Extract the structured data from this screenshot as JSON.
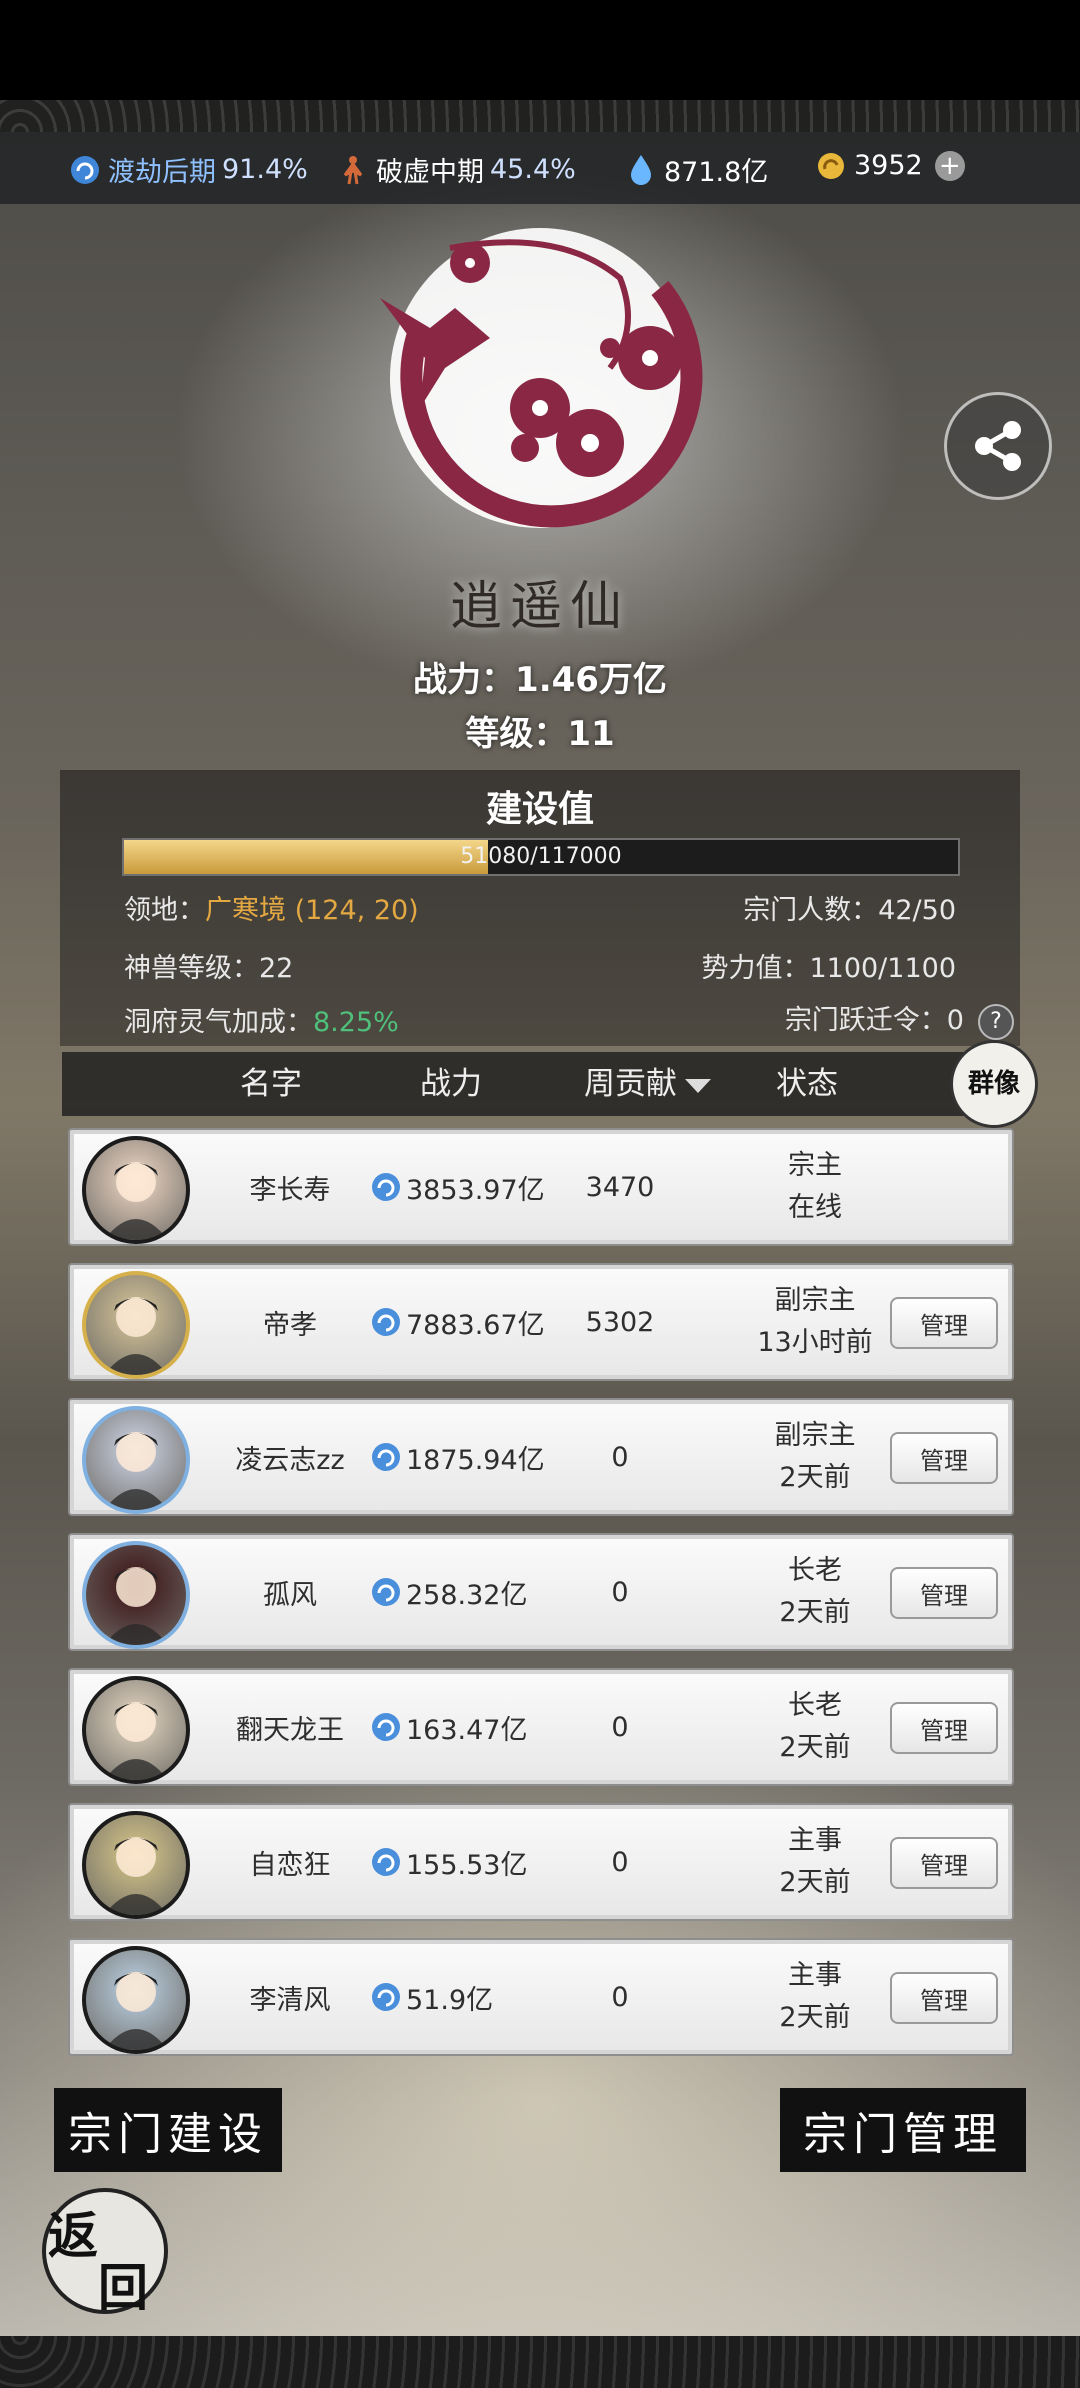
{
  "top_bar": {
    "cultivation": {
      "label": "渡劫后期",
      "percent": "91.4%"
    },
    "body": {
      "label": "破虚中期",
      "percent": "45.4%"
    },
    "spirit_stones": "871.8亿",
    "gold": "3952",
    "plus": "+"
  },
  "sect": {
    "name": "逍遥仙",
    "power_line": "战力：1.46万亿",
    "level_line": "等级：11",
    "build_title": "建设值",
    "build_progress_text": "51080/117000",
    "build_progress": 0.4366,
    "territory_label": "领地：",
    "territory_value": "广寒境 (124, 20)",
    "members_line": "宗门人数：42/50",
    "beast_line": "神兽等级：22",
    "influence_line": "势力值：1100/1100",
    "cave_label": "洞府灵气加成：",
    "cave_value": "8.25%",
    "migrate_line": "宗门跃迁令：0",
    "help": "?"
  },
  "table": {
    "headers": {
      "name": "名字",
      "power": "战力",
      "weekly": "周贡献",
      "status": "状态"
    },
    "group_button": "群像",
    "rows": [
      {
        "name": "李长寿",
        "power": "3853.97亿",
        "weekly": "3470",
        "role": "宗主",
        "last_online": "在线",
        "manage": ""
      },
      {
        "name": "帝孝",
        "power": "7883.67亿",
        "weekly": "5302",
        "role": "副宗主",
        "last_online": "13小时前",
        "manage": "管理"
      },
      {
        "name": "凌云志zz",
        "power": "1875.94亿",
        "weekly": "0",
        "role": "副宗主",
        "last_online": "2天前",
        "manage": "管理"
      },
      {
        "name": "孤风",
        "power": "258.32亿",
        "weekly": "0",
        "role": "长老",
        "last_online": "2天前",
        "manage": "管理"
      },
      {
        "name": "翻天龙王",
        "power": "163.47亿",
        "weekly": "0",
        "role": "长老",
        "last_online": "2天前",
        "manage": "管理"
      },
      {
        "name": "自恋狂",
        "power": "155.53亿",
        "weekly": "0",
        "role": "主事",
        "last_online": "2天前",
        "manage": "管理"
      },
      {
        "name": "李清风",
        "power": "51.9亿",
        "weekly": "0",
        "role": "主事",
        "last_online": "2天前",
        "manage": "管理"
      }
    ]
  },
  "bottom": {
    "build_button": "宗门建设",
    "manage_button": "宗门管理",
    "back_top": "返",
    "back_bottom": "回"
  },
  "colors": {
    "accent_gold": "#e4a843",
    "accent_green": "#4fbf7b",
    "emblem": "#8a2745"
  }
}
